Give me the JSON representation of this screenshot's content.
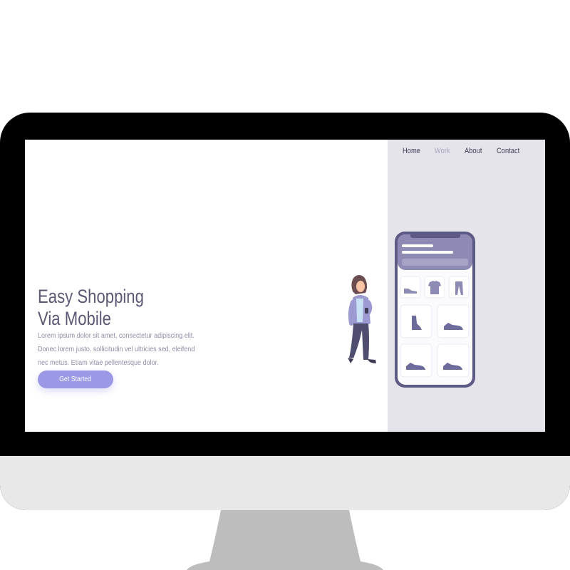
{
  "nav": {
    "items": [
      {
        "label": "Home",
        "active": false
      },
      {
        "label": "Work",
        "active": true
      },
      {
        "label": "About",
        "active": false
      },
      {
        "label": "Contact",
        "active": false
      }
    ]
  },
  "hero": {
    "title_line1": "Easy Shopping",
    "title_line2": "Via Mobile",
    "body": "Lorem ipsum dolor sit amet, consectetur adipiscing elit. Donec lorem justo, sollicitudin vel ultricies sed, eleifend nec metus. Etiam vitae pellentesque dolor.",
    "cta_label": "Get Started"
  },
  "illustration": {
    "phone_products": [
      "shoe-icon",
      "tshirt-icon",
      "pants-icon",
      "boot-icon",
      "sneaker-icon",
      "sneaker-icon",
      "sneaker-icon"
    ]
  },
  "colors": {
    "accent": "#9b98e6",
    "title": "#5b5873",
    "panel": "#e5e4ea",
    "monitor_bezel": "#000000",
    "monitor_chin": "#e8e8e8",
    "stand": "#bdbdbd"
  }
}
